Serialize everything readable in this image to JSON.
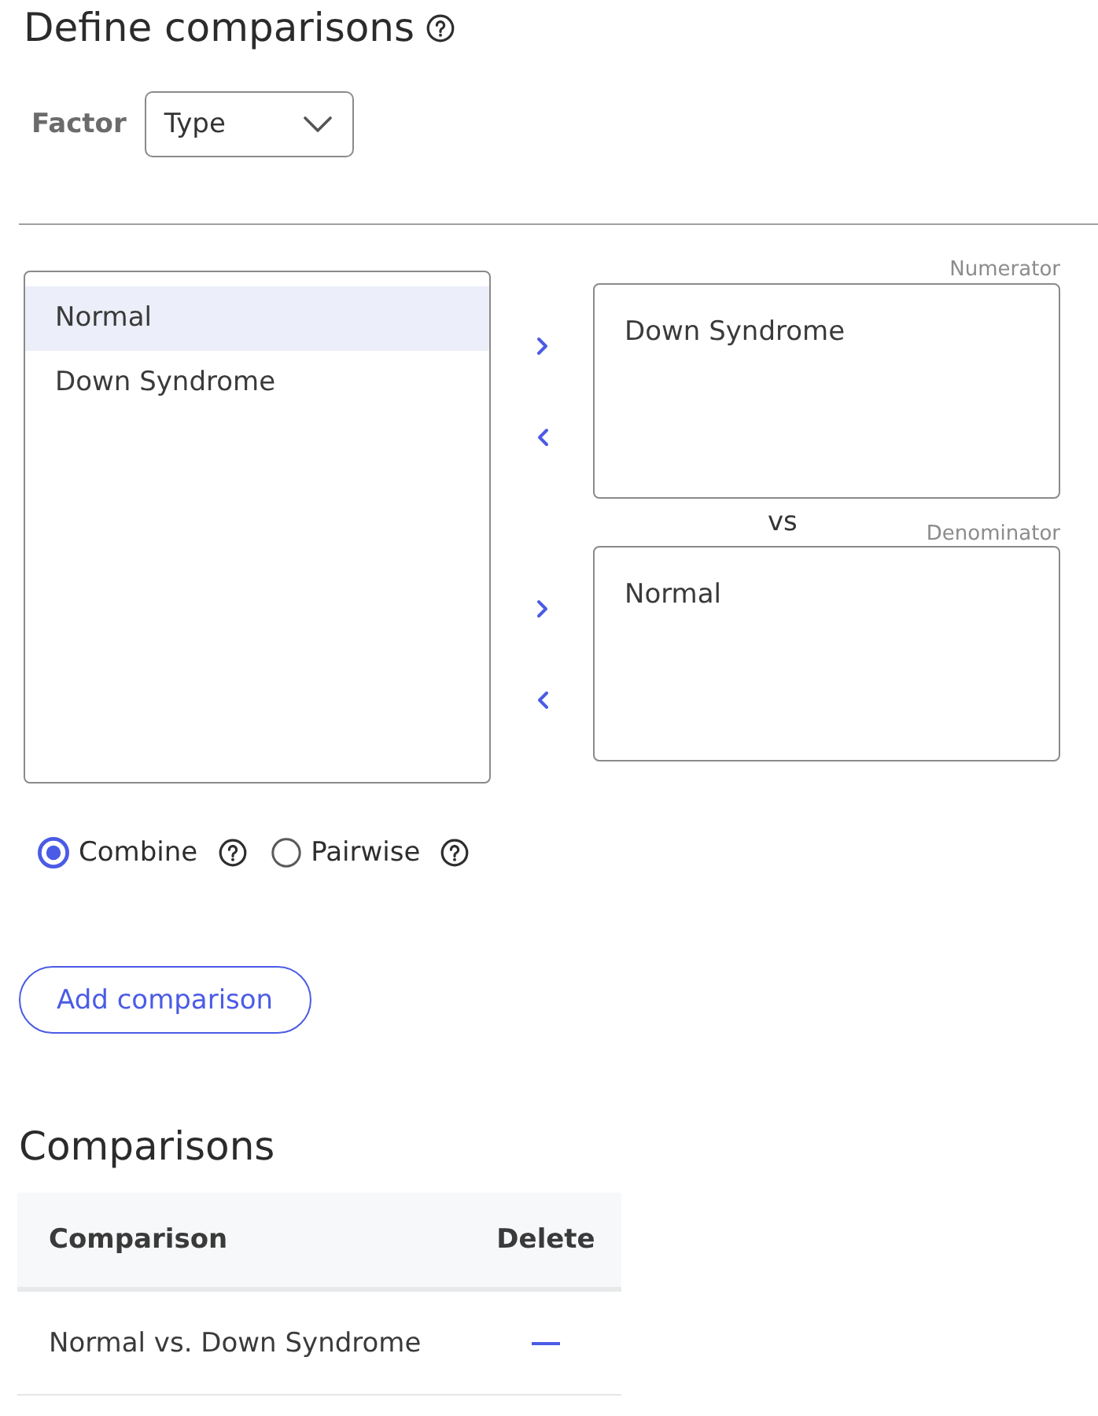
{
  "header": {
    "title": "Define comparisons"
  },
  "factor": {
    "label": "Factor",
    "value": "Type"
  },
  "available_groups": [
    {
      "label": "Normal",
      "selected": true
    },
    {
      "label": "Down Syndrome",
      "selected": false
    }
  ],
  "numerator": {
    "label": "Numerator",
    "items": [
      "Down Syndrome"
    ]
  },
  "separator": "vs",
  "denominator": {
    "label": "Denominator",
    "items": [
      "Normal"
    ]
  },
  "modes": [
    {
      "label": "Combine",
      "selected": true
    },
    {
      "label": "Pairwise",
      "selected": false
    }
  ],
  "add_button": "Add comparison",
  "comparisons": {
    "title": "Comparisons",
    "columns": [
      "Comparison",
      "Delete"
    ],
    "rows": [
      {
        "comparison": "Normal vs. Down Syndrome"
      }
    ]
  }
}
